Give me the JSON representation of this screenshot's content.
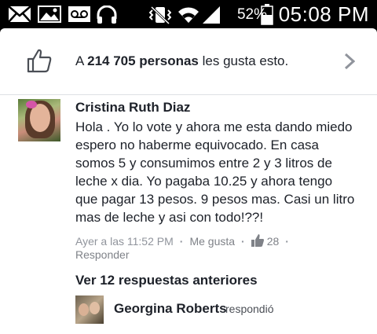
{
  "status_bar": {
    "battery_percent": "52%",
    "time": "05:08 PM",
    "icons": [
      "mail-icon",
      "image-icon",
      "voicemail-icon",
      "headphones-icon",
      "vibrate-icon",
      "wifi-icon",
      "signal-icon",
      "battery-icon"
    ]
  },
  "likes": {
    "prefix": "A ",
    "count": "214 705 personas",
    "suffix": " les gusta esto."
  },
  "comment": {
    "author": "Cristina Ruth Diaz",
    "text": "Hola . Yo lo vote y ahora  me esta dando miedo espero no haberme equivocado. En casa somos 5 y consumimos entre 2 y 3 litros de leche x dia. Yo pagaba 10.25 y ahora tengo que pagar 13 pesos. 9 pesos mas. Casi un litro mas de leche y asi con todo!??!",
    "timestamp": "Ayer a las 11:52 PM",
    "like_label": "Me gusta",
    "like_count": "28",
    "reply_label": "Responder"
  },
  "replies": {
    "previous_label": "Ver 12 respuestas anteriores",
    "last_reply_author": "Georgina Roberts",
    "last_reply_verb": "respondió"
  },
  "colors": {
    "status_bar_bg": "#000000",
    "card_bg": "#ffffff",
    "text_primary": "#1d2129",
    "text_secondary": "#90949c"
  }
}
